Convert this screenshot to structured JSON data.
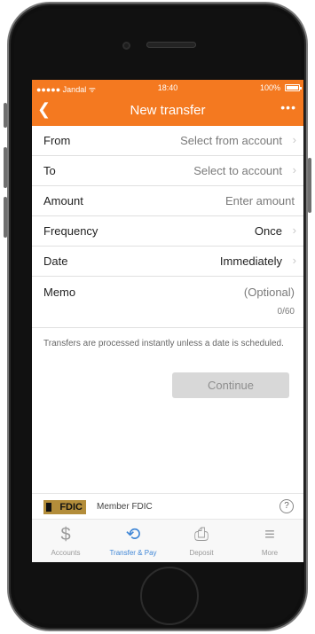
{
  "status_bar": {
    "carrier": "●●●●● Jandal ᯤ",
    "time": "18:40",
    "battery": "100%"
  },
  "nav": {
    "back_icon": "chevron-left-icon",
    "back_glyph": "❮",
    "title": "New transfer",
    "more_glyph": "•••"
  },
  "form": {
    "from": {
      "label": "From",
      "value": "Select from account"
    },
    "to": {
      "label": "To",
      "value": "Select to account"
    },
    "amount": {
      "label": "Amount",
      "placeholder": "Enter amount"
    },
    "frequency": {
      "label": "Frequency",
      "value": "Once"
    },
    "date": {
      "label": "Date",
      "value": "Immediately"
    },
    "memo": {
      "label": "Memo",
      "placeholder": "(Optional)",
      "count": "0/60"
    },
    "chevron_glyph": "›"
  },
  "info_text": "Transfers are processed instantly unless a date is scheduled.",
  "continue_label": "Continue",
  "fdic": {
    "logo_text": "FDIC",
    "member_text": "Member FDIC",
    "help_glyph": "?"
  },
  "tabs": [
    {
      "label": "Accounts",
      "icon": "dollar-icon",
      "glyph": "$",
      "active": false
    },
    {
      "label": "Transfer & Pay",
      "icon": "transfer-pay-icon",
      "glyph": "⟲",
      "active": true
    },
    {
      "label": "Deposit",
      "icon": "check-deposit-icon",
      "glyph": "⎙",
      "active": false
    },
    {
      "label": "More",
      "icon": "menu-icon",
      "glyph": "≡",
      "active": false
    }
  ],
  "colors": {
    "brand_orange": "#f47920",
    "active_tab_blue": "#3f86d6",
    "fdic_gold": "#b38d3a"
  }
}
